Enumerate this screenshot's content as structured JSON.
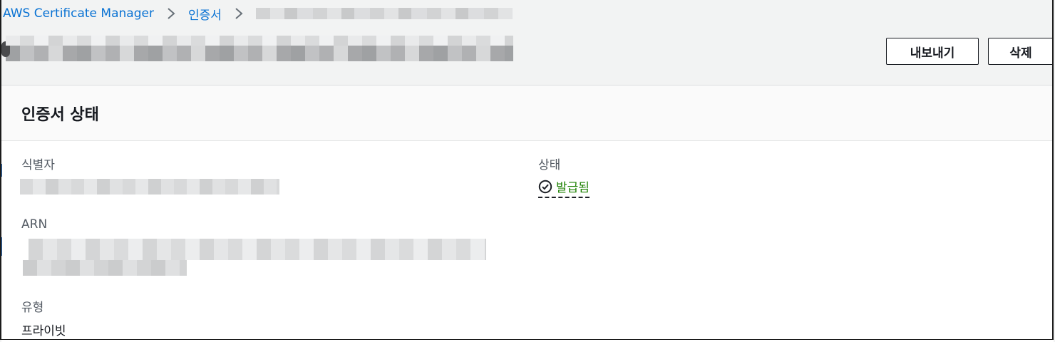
{
  "breadcrumb": {
    "service": "AWS Certificate Manager",
    "section": "인증서"
  },
  "header": {
    "export_label": "내보내기",
    "delete_label": "삭제"
  },
  "panel": {
    "title": "인증서 상태",
    "identifier_label": "식별자",
    "status_label": "상태",
    "status_value": "발급됨",
    "arn_label": "ARN",
    "type_label": "유형",
    "type_value": "프라이빗"
  },
  "colors": {
    "link": "#0972d3",
    "status_success": "#1d8102",
    "background": "#f2f3f3"
  },
  "icons": {
    "breadcrumb_separator": "chevron-right-icon",
    "status": "check-circle-icon"
  }
}
